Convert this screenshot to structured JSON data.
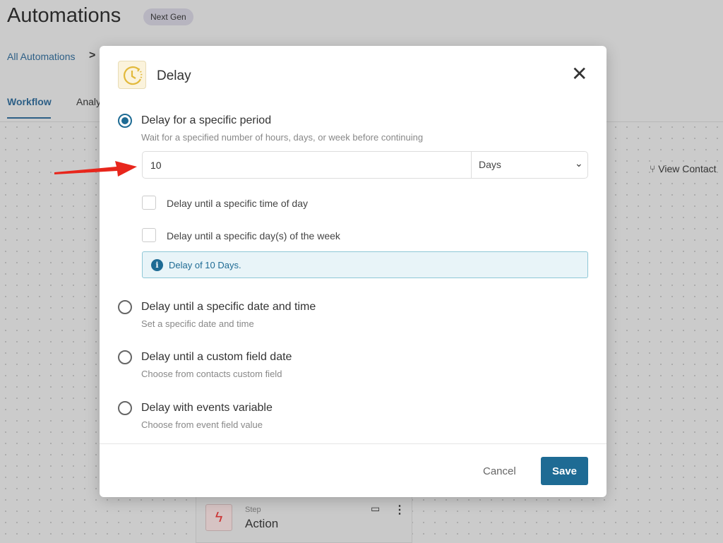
{
  "page": {
    "title": "Automations",
    "badge": "Next Gen",
    "breadcrumb": "All Automations",
    "tabs": [
      {
        "label": "Workflow"
      },
      {
        "label": "Analy"
      }
    ],
    "view_contacts": "View Contact"
  },
  "step_card": {
    "label": "Step",
    "name": "Action",
    "icon": "lightning-icon"
  },
  "modal": {
    "title": "Delay",
    "icon": "clock-icon",
    "options": [
      {
        "label": "Delay for a specific period",
        "desc": "Wait for a specified number of hours, days, or week before continuing",
        "selected": true
      },
      {
        "label": "Delay until a specific date and time",
        "desc": "Set a specific date and time",
        "selected": false
      },
      {
        "label": "Delay until a custom field date",
        "desc": "Choose from contacts custom field",
        "selected": false
      },
      {
        "label": "Delay with events variable",
        "desc": "Choose from event field value",
        "selected": false
      }
    ],
    "amount": "10",
    "unit": "Days",
    "checkboxes": [
      {
        "label": "Delay until a specific time of day",
        "checked": false
      },
      {
        "label": "Delay until a specific day(s) of the week",
        "checked": false
      }
    ],
    "info": "Delay of 10 Days.",
    "cancel": "Cancel",
    "save": "Save"
  },
  "colors": {
    "accent": "#1e6b94",
    "arrow": "#e8261c"
  }
}
